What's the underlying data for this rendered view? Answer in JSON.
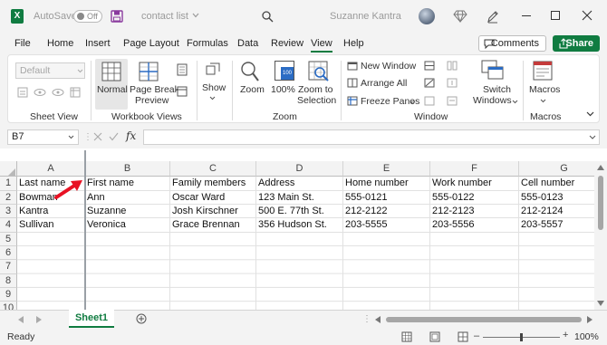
{
  "titlebar": {
    "autosave_label": "AutoSave",
    "autosave_state": "Off",
    "doc_title": "contact list",
    "user_name": "Suzanne Kantra"
  },
  "menu": {
    "items": [
      "File",
      "Home",
      "Insert",
      "Page Layout",
      "Formulas",
      "Data",
      "Review",
      "View",
      "Help"
    ],
    "active": "View",
    "comments_label": "Comments",
    "share_label": "Share"
  },
  "ribbon": {
    "sheet_view": {
      "label": "Sheet View",
      "default_value": "Default"
    },
    "workbook_views": {
      "label": "Workbook Views",
      "normal": "Normal",
      "page_break_1": "Page Break",
      "page_break_2": "Preview"
    },
    "show": {
      "label": "Show"
    },
    "zoom": {
      "label": "Zoom",
      "zoom": "Zoom",
      "hundred": "100%",
      "hundred_icon": "100",
      "zoom_sel_1": "Zoom to",
      "zoom_sel_2": "Selection"
    },
    "window": {
      "label": "Window",
      "new_window": "New Window",
      "arrange_all": "Arrange All",
      "freeze_panes": "Freeze Panes",
      "switch_1": "Switch",
      "switch_2": "Windows"
    },
    "macros": {
      "label": "Macros",
      "macros": "Macros"
    }
  },
  "formula_bar": {
    "name_box": "B7",
    "fx": "fx",
    "value": ""
  },
  "columns": [
    "A",
    "B",
    "C",
    "D",
    "E",
    "F",
    "G"
  ],
  "rows": [
    [
      "Last name",
      "First name",
      "Family members",
      "Address",
      "Home number",
      "Work number",
      "Cell number"
    ],
    [
      "Bowman",
      "Ann",
      "Oscar Ward",
      "123 Main St.",
      "555-0121",
      "555-0122",
      "555-0123"
    ],
    [
      "Kantra",
      "Suzanne",
      "Josh Kirschner",
      "500 E. 77th St.",
      "212-2122",
      "212-2123",
      "212-2124"
    ],
    [
      "Sullivan",
      "Veronica",
      "Grace Brennan",
      "356 Hudson St.",
      "203-5555",
      "203-5556",
      "203-5557"
    ]
  ],
  "sheet_tab": "Sheet1",
  "status": {
    "ready": "Ready",
    "zoom": "100%"
  },
  "colors": {
    "excel_green": "#107c41",
    "arrow_red": "#e81123"
  }
}
